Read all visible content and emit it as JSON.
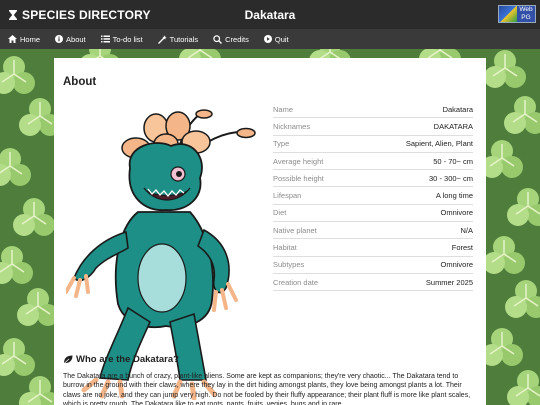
{
  "header": {
    "brand": "SPECIES DIRECTORY",
    "title": "Dakatara",
    "badge_text": "Web PG"
  },
  "nav": [
    {
      "label": "Home",
      "icon": "home-icon"
    },
    {
      "label": "About",
      "icon": "info-icon"
    },
    {
      "label": "To-do list",
      "icon": "list-icon"
    },
    {
      "label": "Tutorials",
      "icon": "wand-icon"
    },
    {
      "label": "Credits",
      "icon": "search-icon"
    },
    {
      "label": "Quit",
      "icon": "quit-icon"
    }
  ],
  "about": {
    "heading": "About",
    "rows": [
      {
        "key": "Name",
        "value": "Dakatara"
      },
      {
        "key": "Nicknames",
        "value": "DAKATARA"
      },
      {
        "key": "Type",
        "value": "Sapient, Alien, Plant"
      },
      {
        "key": "Average height",
        "value": "50 - 70~ cm"
      },
      {
        "key": "Possible height",
        "value": "30 - 300~ cm"
      },
      {
        "key": "Lifespan",
        "value": "A long time"
      },
      {
        "key": "Diet",
        "value": "Omnivore"
      },
      {
        "key": "Native planet",
        "value": "N/A"
      },
      {
        "key": "Habitat",
        "value": "Forest"
      },
      {
        "key": "Subtypes",
        "value": "Omnivore"
      },
      {
        "key": "Creation date",
        "value": "Summer 2025"
      }
    ]
  },
  "section": {
    "title": "Who are the Dakatara?",
    "text": "The Dakatara are a bunch of crazy, plant-like aliens. Some are kept as companions; they're very chaotic... The Dakatara tend to burrow in the ground with their claws, where they lay in the dirt hiding amongst plants, they love being amongst plants a lot. Their claws are no joke, and they can jump very high. Do not be fooled by their fluffy appearance; their plant fluff is more like plant scales, which is pretty rough. The Dakatara like to eat roots, pants, fruits, vegies, bugs and in rare"
  },
  "colors": {
    "header_bg": "#2b2b2b",
    "nav_bg": "#3a3a3a",
    "creature_teal": "#1d8f86",
    "creature_peach": "#f4b689",
    "clover_green": "#9ccf72"
  }
}
